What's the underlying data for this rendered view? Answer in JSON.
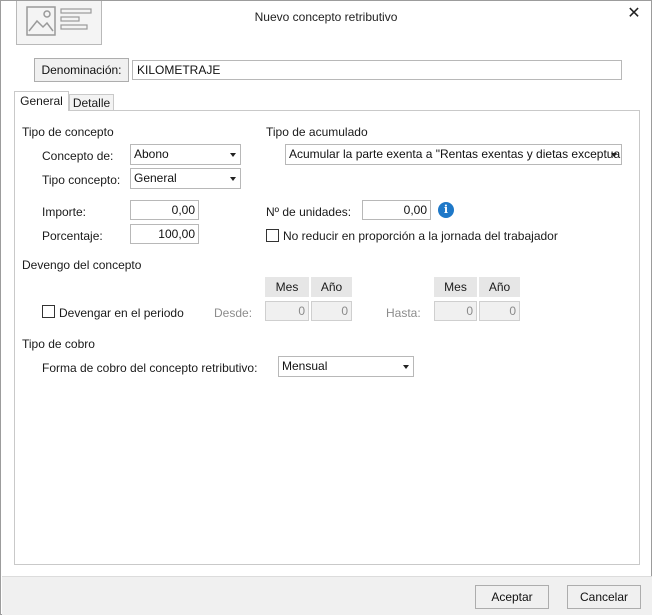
{
  "window": {
    "title": "Nuevo concepto retributivo",
    "close_icon": "close-icon"
  },
  "denominacion": {
    "button_label": "Denominación:",
    "value": "KILOMETRAJE"
  },
  "tabs": [
    {
      "label": "General",
      "active": true
    },
    {
      "label": "Detalle",
      "active": false
    }
  ],
  "general": {
    "tipo_concepto": {
      "heading": "Tipo de concepto",
      "concepto_de_label": "Concepto de:",
      "concepto_de_value": "Abono",
      "tipo_concepto_label": "Tipo concepto:",
      "tipo_concepto_value": "General",
      "importe_label": "Importe:",
      "importe_value": "0,00",
      "porcentaje_label": "Porcentaje:",
      "porcentaje_value": "100,00"
    },
    "tipo_acumulado": {
      "heading": "Tipo de acumulado",
      "value": "Acumular la parte exenta a \"Rentas exentas y dietas exceptua",
      "unidades_label": "Nº de unidades:",
      "unidades_value": "0,00",
      "no_reducir_label": "No reducir en proporción a la jornada del trabajador",
      "no_reducir_checked": false
    },
    "devengo": {
      "heading": "Devengo del concepto",
      "devengar_label": "Devengar en el periodo",
      "devengar_checked": false,
      "desde_label": "Desde:",
      "hasta_label": "Hasta:",
      "mes_header": "Mes",
      "anio_header": "Año",
      "desde_mes": "0",
      "desde_anio": "0",
      "hasta_mes": "0",
      "hasta_anio": "0"
    },
    "cobro": {
      "heading": "Tipo de cobro",
      "forma_label": "Forma de cobro del concepto retributivo:",
      "forma_value": "Mensual"
    }
  },
  "footer": {
    "aceptar_label": "Aceptar",
    "cancelar_label": "Cancelar"
  },
  "colors": {
    "info_icon": "#1e78c8",
    "footer_bg": "#f0f0f0"
  }
}
